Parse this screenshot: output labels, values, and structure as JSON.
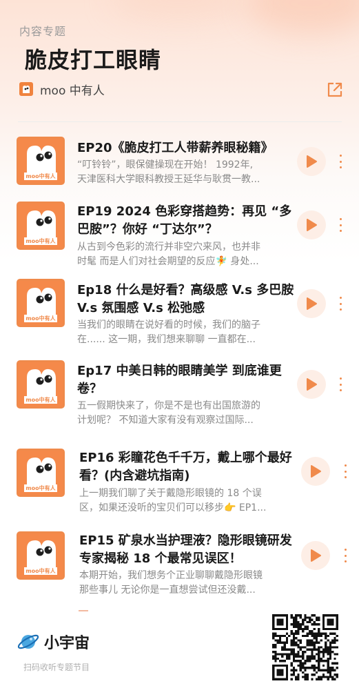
{
  "header": {
    "kicker": "内容专题",
    "title": "脆皮打工眼睛",
    "author": "moo 中有人",
    "share_icon": "share-icon"
  },
  "episodes": [
    {
      "title_lines": [
        "EP20《脆皮打工人带薪养眼秘籍》"
      ],
      "desc_lines": [
        "“叮铃铃”，眼保健操现在开始！ 1992年,",
        "天津医科大学眼科教授王延华与耿贯一教..."
      ]
    },
    {
      "title_lines": [
        "EP19 2024 色彩穿搭趋势：再见 “多",
        "巴胺”？你好 “丁达尔”？"
      ],
      "desc_lines": [
        "从古到今色彩的流行并非空穴来风，也并非",
        "时髦 而是人们对社会期望的反应🧚 身处..."
      ]
    },
    {
      "title_lines": [
        "Ep18 什么是好看？高级感 V.s 多巴胺",
        "V.s 氛围感 V.s 松弛感"
      ],
      "desc_lines": [
        "当我们的眼睛在说好看的时候，我们的脑子",
        "在...... 这一期，我们想来聊聊 一直都在..."
      ]
    },
    {
      "title_lines": [
        "Ep17 中美日韩的眼睛美学 到底谁更",
        "卷？"
      ],
      "desc_lines": [
        "五一假期快来了，你是不是也有出国旅游的",
        "计划呢？ 不知道大家有没有观察过国际..."
      ]
    },
    {
      "title_lines": [
        "EP16 彩瞳花色千千万，戴上哪个最好",
        "看？(内含避坑指南)"
      ],
      "desc_lines": [
        "上一期我们聊了关于戴隐形眼镜的 18 个误",
        "区，如果还没听的宝贝们可以移步👉 EP1..."
      ]
    },
    {
      "title_lines": [
        "EP15 矿泉水当护理液？隐形眼镜研发",
        "专家揭秘 18 个最常见误区！"
      ],
      "desc_lines": [
        "本期开始，我们想务个正业聊聊戴隐形眼镜",
        "那些事儿 无论你是一直想尝试但还没戴..."
      ]
    }
  ],
  "cover": {
    "label": "moo中有人",
    "color": "#f5894a"
  },
  "footer": {
    "brand": "小宇宙",
    "hint": "扫码收听专题节目"
  },
  "colors": {
    "accent": "#f08a4b",
    "play_bg": "#fdeee6"
  }
}
